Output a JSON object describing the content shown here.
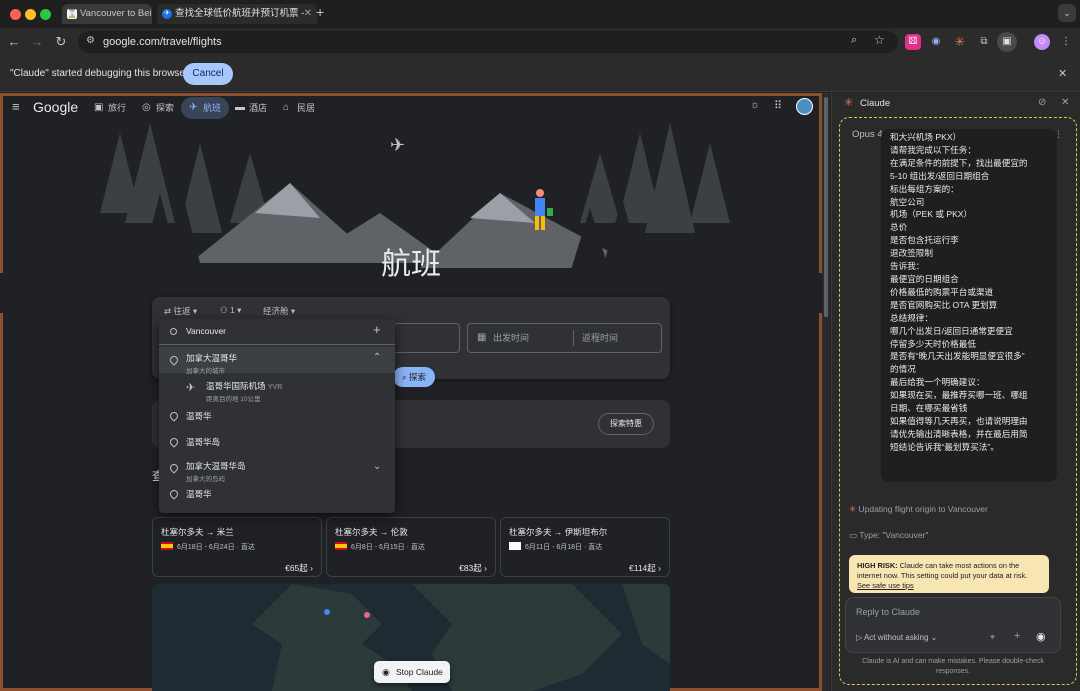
{
  "browser": {
    "tabs": [
      {
        "title": "Vancouver to Bei",
        "active": false
      },
      {
        "title": "查找全球低价航班并预订机票 -",
        "active": true
      }
    ],
    "url": "google.com/travel/flights",
    "debug_message": "\"Claude\" started debugging this browser",
    "cancel_label": "Cancel"
  },
  "google": {
    "logo": "Google",
    "nav": [
      "旅行",
      "探索",
      "航班",
      "酒店",
      "民居"
    ],
    "hero_title": "航班",
    "trip_type": "往返",
    "passengers": "1",
    "cabin": "经济舱",
    "depart_placeholder": "出发时间",
    "return_placeholder": "返程时间",
    "explore_label": "探索",
    "origin_input": "Vancouver",
    "suggestions": [
      {
        "name": "加拿大温哥华",
        "sub": "加拿大的城市",
        "kind": "city"
      },
      {
        "name": "温哥华国际机场",
        "code": "YVR",
        "sub": "距离目的地 10公里",
        "kind": "airport"
      },
      {
        "name": "温哥华",
        "kind": "place"
      },
      {
        "name": "温哥华岛",
        "kind": "place"
      },
      {
        "name": "加拿大温哥华岛",
        "sub": "加拿大的岛屿",
        "kind": "place"
      },
      {
        "name": "温哥华",
        "kind": "place"
      }
    ],
    "banner_button": "探索特惠",
    "section_heading_partial": "查",
    "routes": [
      {
        "route": "杜塞尔多夫 → 米兰",
        "dates": "6月18日 - 6月24日",
        "stops": "直达",
        "price": "€65起"
      },
      {
        "route": "杜塞尔多夫 → 伦敦",
        "dates": "6月8日 - 6月15日",
        "stops": "直达",
        "price": "€83起"
      },
      {
        "route": "杜塞尔多夫 → 伊斯坦布尔",
        "dates": "6月11日 - 6月18日",
        "stops": "直达",
        "price": "€114起"
      }
    ],
    "stop_claude": "Stop Claude"
  },
  "claude": {
    "title": "Claude",
    "model": "Opus 4.6",
    "message_lines": [
      "和大兴机场 PKX）",
      "请帮我完成以下任务：",
      "在满足条件的前提下，找出最便宜的",
      "5-10 组出发/返回日期组合",
      "标出每组方案的：",
      "航空公司",
      "机场（PEK 或 PKX）",
      "总价",
      "是否包含托运行李",
      "退改签限制",
      "告诉我：",
      "最便宜的日期组合",
      "价格最低的购票平台或渠道",
      "是否官网购买比 OTA 更划算",
      "总结规律：",
      "哪几个出发日/返回日通常更便宜",
      "停留多少天时价格最低",
      "是否有“晚几天出发能明显便宜很多”",
      "的情况",
      "最后给我一个明确建议：",
      "如果现在买，最推荐买哪一班、哪组",
      "日期、在哪买最省钱",
      "如果值得等几天再买，也请说明理由",
      "请优先输出清晰表格，并在最后用简",
      "短结论告诉我“最划算买法”。"
    ],
    "status_updating": "Updating flight origin to Vancouver",
    "status_type": "Type: \"Vancouver\"",
    "warning_title": "HIGH RISK:",
    "warning_body": "Claude can take most actions on the internet now. This setting could put your data at risk.",
    "warning_link": "See safe use tips",
    "reply_placeholder": "Reply to Claude",
    "act_mode": "Act without asking",
    "footnote": "Claude is AI and can make mistakes. Please double-check responses."
  },
  "colors": {
    "accent": "#8ab4f8",
    "claude_orange": "#d97757",
    "warn_bg": "#f7e5b2",
    "dashed": "#e6c64a"
  }
}
